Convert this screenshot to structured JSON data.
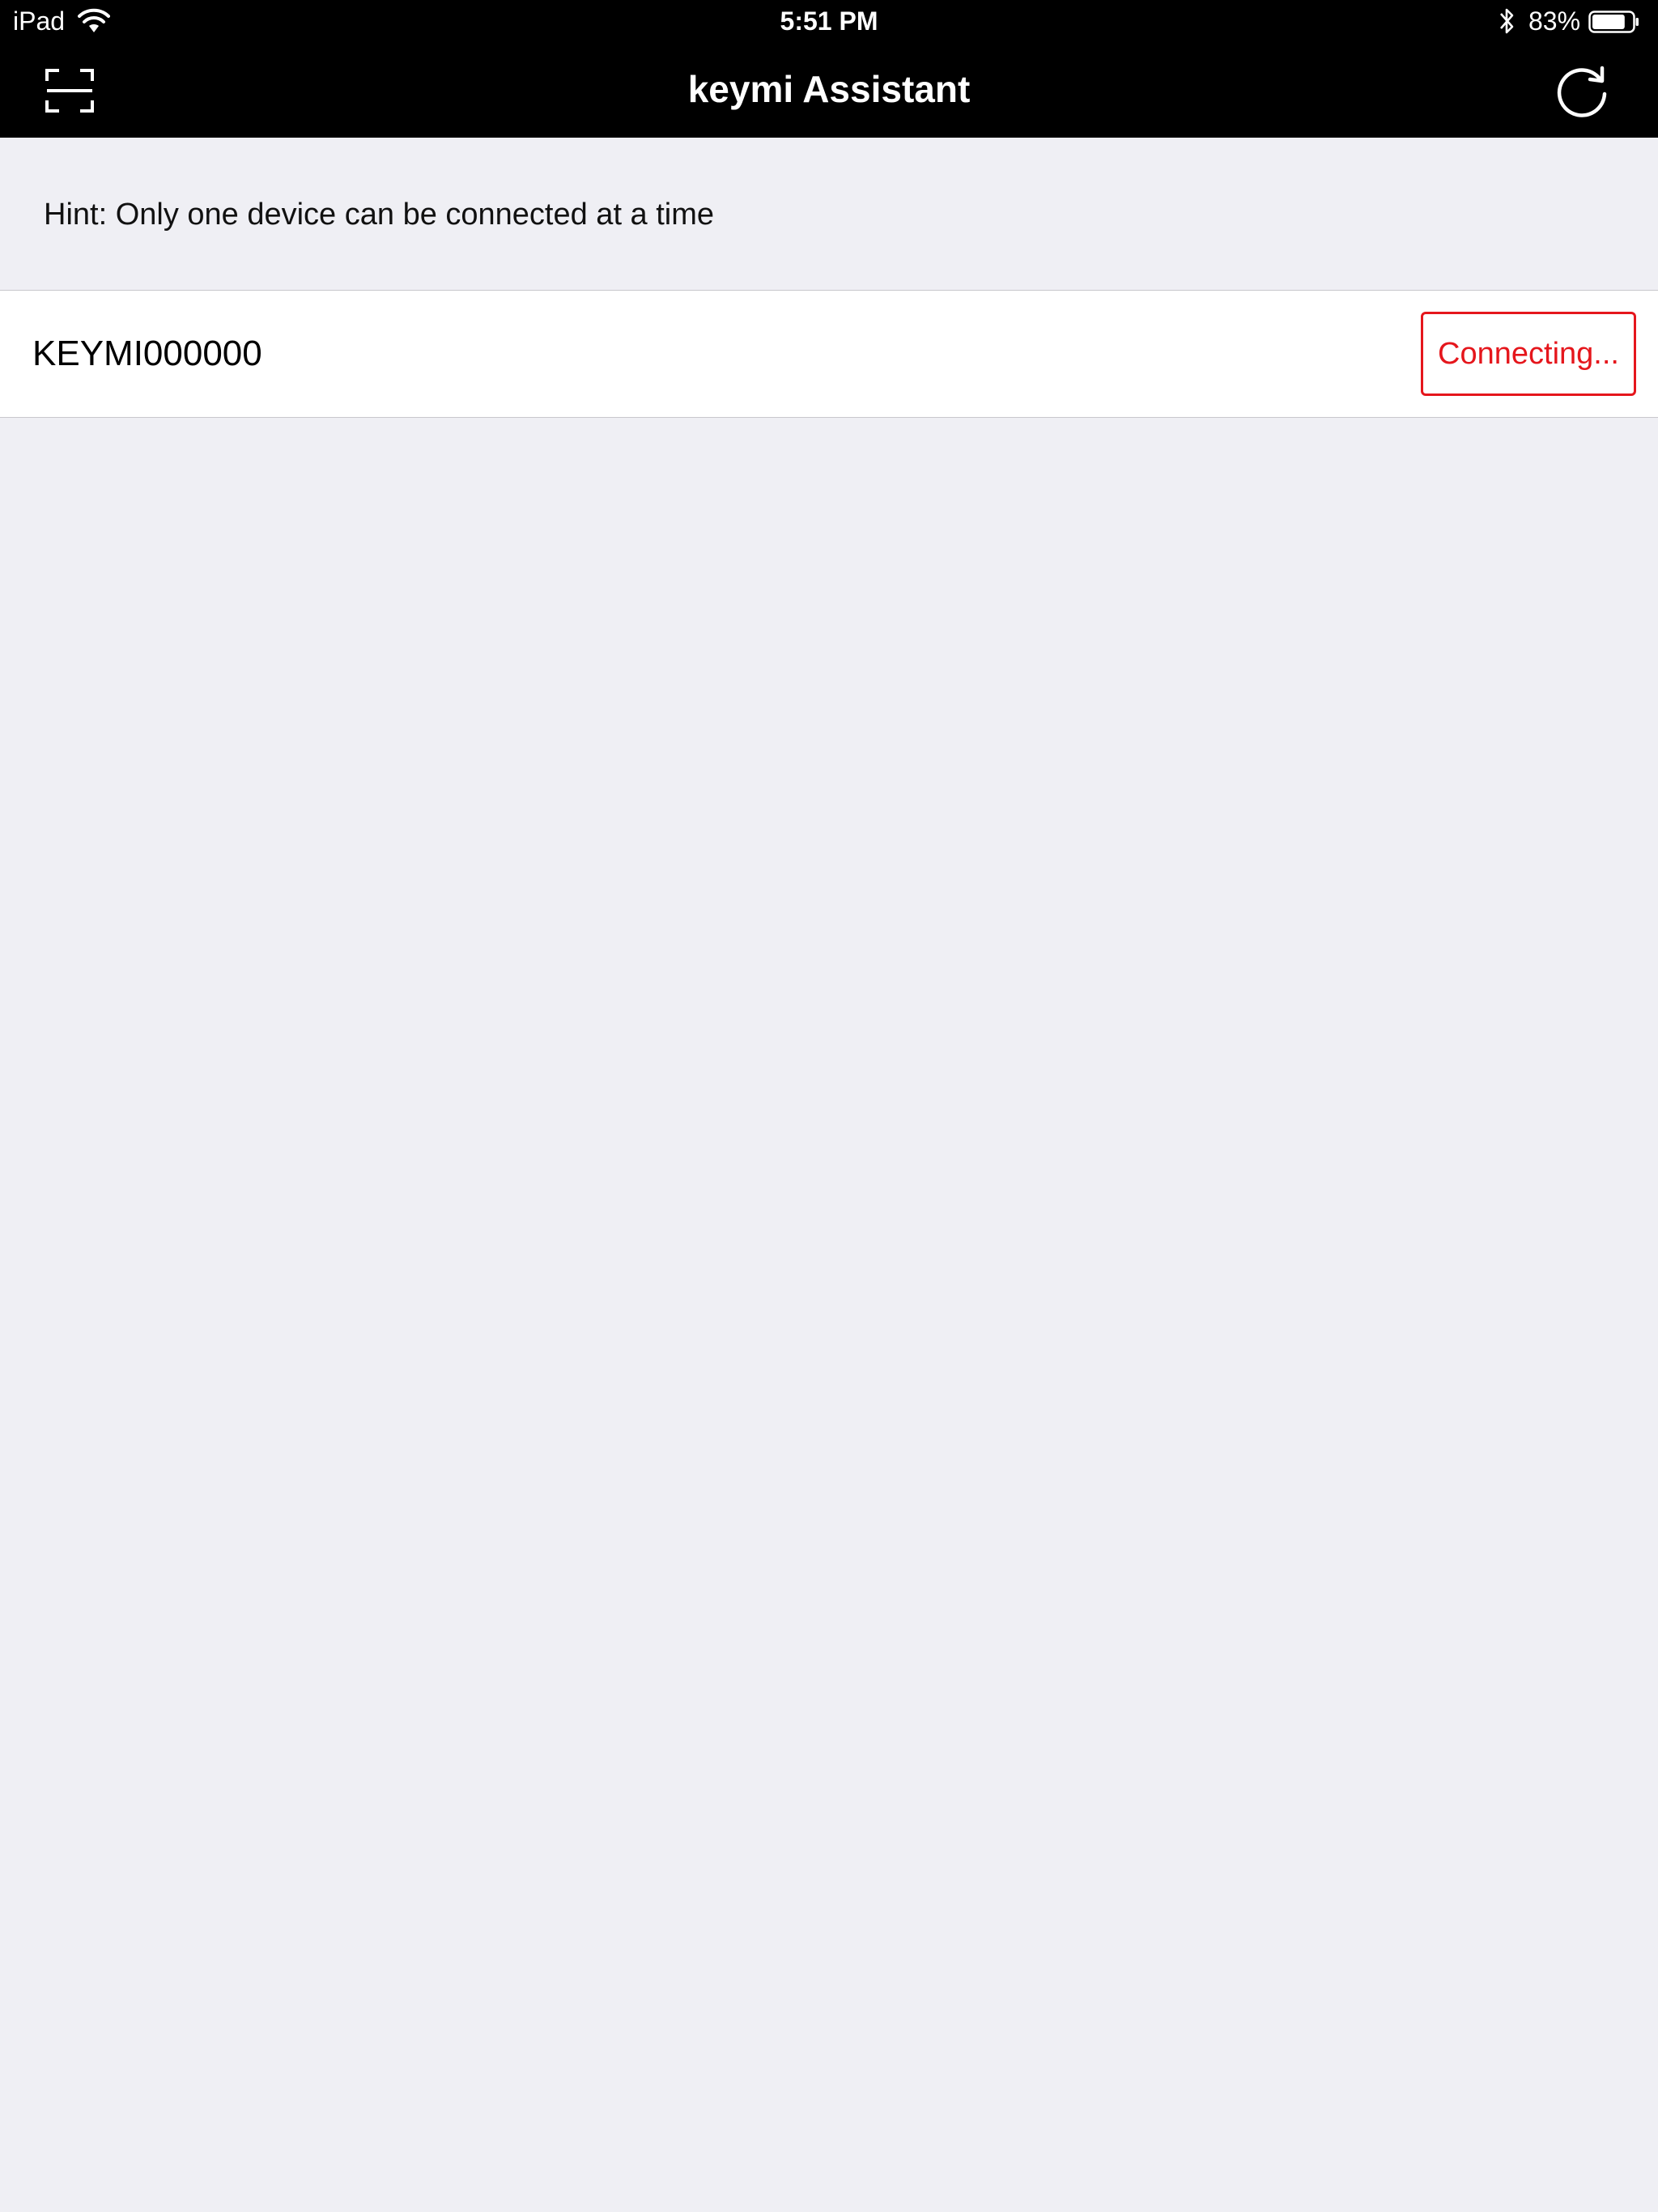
{
  "status_bar": {
    "device": "iPad",
    "time": "5:51 PM",
    "battery": "83%",
    "battery_level": 0.83,
    "icons": [
      "wifi-icon",
      "bluetooth-icon",
      "battery-icon"
    ]
  },
  "nav_bar": {
    "title": "keymi Assistant",
    "left_icon": "scan-icon",
    "right_icon": "refresh-icon"
  },
  "hint": "Hint: Only one device can be connected at a time",
  "devices": [
    {
      "name": "KEYMI000000",
      "status": "Connecting..."
    }
  ],
  "colors": {
    "header_bg": "#000000",
    "page_bg": "#EFEFF4",
    "row_bg": "#FFFFFF",
    "accent": "#E5161C"
  }
}
